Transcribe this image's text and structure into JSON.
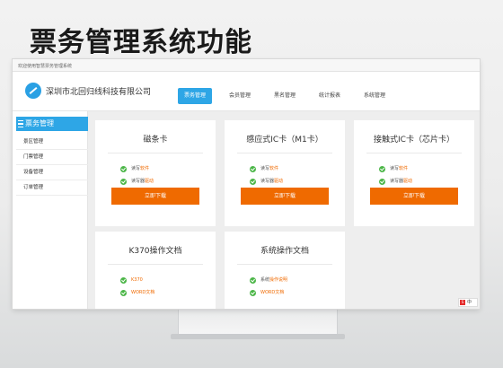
{
  "slide": {
    "title": "票务管理系统功能"
  },
  "browser": {
    "title": "欢迎使用智慧票务管理系统"
  },
  "header": {
    "company_name": "深圳市北回归线科技有限公司",
    "nav": [
      {
        "label": "票务管理",
        "active": true
      },
      {
        "label": "会员管理",
        "active": false
      },
      {
        "label": "黑名管理",
        "active": false
      },
      {
        "label": "统计报表",
        "active": false
      },
      {
        "label": "系统管理",
        "active": false
      }
    ]
  },
  "sidebar": {
    "title": "票务管理",
    "items": [
      "景区管理",
      "门票管理",
      "设备管理",
      "订单管理"
    ]
  },
  "cards": [
    {
      "title": "磁条卡",
      "features": [
        {
          "prefix": "读写",
          "highlight": "软件"
        },
        {
          "prefix": "读写器",
          "highlight": "驱动"
        }
      ],
      "button": "立即下载"
    },
    {
      "title": "感应式IC卡（M1卡）",
      "features": [
        {
          "prefix": "读写",
          "highlight": "软件"
        },
        {
          "prefix": "读写器",
          "highlight": "驱动"
        }
      ],
      "button": "立即下载"
    },
    {
      "title": "接触式IC卡（芯片卡）",
      "features": [
        {
          "prefix": "读写",
          "highlight": "软件"
        },
        {
          "prefix": "读写器",
          "highlight": "驱动"
        }
      ],
      "button": "立即下载"
    },
    {
      "title": "K370操作文档",
      "features": [
        {
          "prefix": "",
          "highlight": "K370"
        },
        {
          "prefix": "",
          "highlight": "WORD文档"
        }
      ]
    },
    {
      "title": "系统操作文档",
      "features": [
        {
          "prefix": "系统",
          "highlight": "操作说明"
        },
        {
          "prefix": "",
          "highlight": "WORD文档"
        }
      ]
    }
  ],
  "ime": {
    "logo": "S",
    "label": "中"
  },
  "colors": {
    "accent_blue": "#2ea6e6",
    "button_orange": "#ef6a00",
    "check_green": "#4cb648"
  }
}
